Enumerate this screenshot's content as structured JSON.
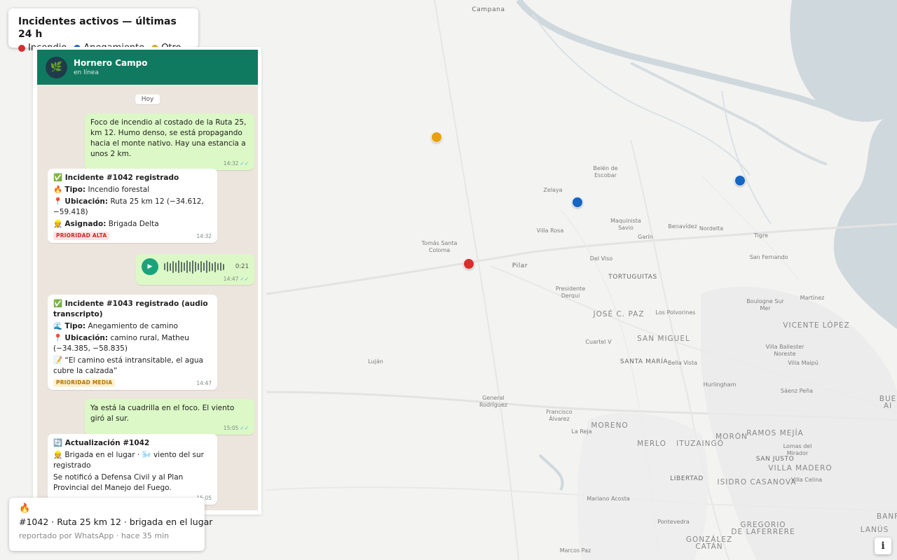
{
  "map": {
    "labels": [
      {
        "text": "Campana",
        "cls": "city"
      },
      {
        "text": "Belén de\nEscobar",
        "cls": ""
      },
      {
        "text": "Zelaya",
        "cls": ""
      },
      {
        "text": "Maquinista\nSavio",
        "cls": ""
      },
      {
        "text": "Benavídez",
        "cls": ""
      },
      {
        "text": "Nordelta",
        "cls": ""
      },
      {
        "text": "Tigre",
        "cls": ""
      },
      {
        "text": "Villa Rosa",
        "cls": ""
      },
      {
        "text": "Garín",
        "cls": ""
      },
      {
        "text": "Tomás Santa\nColoma",
        "cls": ""
      },
      {
        "text": "Pilar",
        "cls": "city"
      },
      {
        "text": "Del Viso",
        "cls": ""
      },
      {
        "text": "San Fernando",
        "cls": ""
      },
      {
        "text": "TORTUGUITAS",
        "cls": "city"
      },
      {
        "text": "Presidente\nDerqui",
        "cls": ""
      },
      {
        "text": "Boulogne Sur\nMer",
        "cls": ""
      },
      {
        "text": "Martínez",
        "cls": ""
      },
      {
        "text": "JOSÉ C. PAZ",
        "cls": "big"
      },
      {
        "text": "Los Polvorines",
        "cls": ""
      },
      {
        "text": "VICENTE LÓPEZ",
        "cls": "big"
      },
      {
        "text": "SAN MIGUEL",
        "cls": "big"
      },
      {
        "text": "Cuartel V",
        "cls": ""
      },
      {
        "text": "Villa Ballester\nNoreste",
        "cls": ""
      },
      {
        "text": "Luján",
        "cls": ""
      },
      {
        "text": "SANTA MARÍA",
        "cls": "city"
      },
      {
        "text": "Bella Vista",
        "cls": ""
      },
      {
        "text": "Villa Maipú",
        "cls": ""
      },
      {
        "text": "Hurlingham",
        "cls": ""
      },
      {
        "text": "Sáenz Peña",
        "cls": ""
      },
      {
        "text": "BUE\nAI",
        "cls": "big"
      },
      {
        "text": "General\nRodríguez",
        "cls": ""
      },
      {
        "text": "Francisco\nÁlvarez",
        "cls": ""
      },
      {
        "text": "MORENO",
        "cls": "big"
      },
      {
        "text": "La Reja",
        "cls": ""
      },
      {
        "text": "RAMOS MEJÍA",
        "cls": "big"
      },
      {
        "text": "MORÓN",
        "cls": "big"
      },
      {
        "text": "MERLO",
        "cls": "big"
      },
      {
        "text": "ITUZAINGÓ",
        "cls": "big"
      },
      {
        "text": "Lomas del\nMirador",
        "cls": ""
      },
      {
        "text": "SAN JUSTO",
        "cls": "city"
      },
      {
        "text": "VILLA MADERO",
        "cls": "big"
      },
      {
        "text": "LIBERTAD",
        "cls": "city"
      },
      {
        "text": "ISIDRO CASANOVA",
        "cls": "big"
      },
      {
        "text": "Villa Celina",
        "cls": ""
      },
      {
        "text": "Mariano Acosta",
        "cls": ""
      },
      {
        "text": "Pontevedra",
        "cls": ""
      },
      {
        "text": "GREGORIO\nDE LAFERRERE",
        "cls": "big"
      },
      {
        "text": "LANÚS",
        "cls": "big"
      },
      {
        "text": "GONZÁLEZ\nCATÁN",
        "cls": "big"
      },
      {
        "text": "Marcos Paz",
        "cls": ""
      },
      {
        "text": "BANF",
        "cls": "big"
      }
    ],
    "markers": [
      {
        "type": "otro",
        "color": "#e6a10f"
      },
      {
        "type": "anegamiento",
        "color": "#1665c1"
      },
      {
        "type": "anegamiento",
        "color": "#1665c1"
      },
      {
        "type": "incendio",
        "color": "#d62d2d"
      }
    ]
  },
  "legend": {
    "title": "Incidentes activos — últimas 24 h",
    "items": [
      {
        "label": "Incendio",
        "color": "#d62d2d"
      },
      {
        "label": "Anegamiento",
        "color": "#1665c1"
      },
      {
        "label": "Otro",
        "color": "#e6a10f"
      }
    ]
  },
  "chat": {
    "contact_name": "Hornero Campo",
    "contact_status": "en línea",
    "avatar_icon": "🌿",
    "day_chip": "Hoy",
    "msg1": {
      "text": "Foco de incendio al costado de la Ruta 25, km 12. Humo denso, se está propagando hacia el monte nativo. Hay una estancia a unos 2 km.",
      "time": "14:32",
      "ticks": "✓✓"
    },
    "msg2": {
      "title": "✅ Incidente #1042 registrado",
      "tipo_icon": "🔥",
      "tipo_label": "Tipo:",
      "tipo_value": "Incendio forestal",
      "ubic_icon": "📍",
      "ubic_label": "Ubicación:",
      "ubic_value": "Ruta 25 km 12 (−34.612, −59.418)",
      "asig_icon": "👷",
      "asig_label": "Asignado:",
      "asig_value": "Brigada Delta",
      "badge": "PRIORIDAD ALTA",
      "time": "14:32"
    },
    "msg3": {
      "duration": "0:21",
      "time": "14:47",
      "ticks": "✓✓",
      "play_icon": "▶",
      "wave_level": [
        0.35,
        0.6,
        0.45,
        0.8,
        0.55,
        0.9,
        0.7,
        0.5,
        0.85,
        0.65,
        0.95,
        0.6,
        0.4,
        0.75,
        0.5,
        0.85,
        0.6,
        0.45,
        0.7,
        0.35,
        0.5,
        0.3
      ]
    },
    "msg4": {
      "title": "✅ Incidente #1043 registrado (audio transcripto)",
      "tipo_icon": "🌊",
      "tipo_label": "Tipo:",
      "tipo_value": "Anegamiento de camino",
      "ubic_icon": "📍",
      "ubic_label": "Ubicación:",
      "ubic_value": "camino rural, Matheu (−34.385, −58.835)",
      "quote_icon": "📝",
      "quote": "“El camino está intransitable, el agua cubre la calzada”",
      "badge": "PRIORIDAD MEDIA",
      "time": "14:47"
    },
    "msg5": {
      "text": "Ya está la cuadrilla en el foco. El viento giró al sur.",
      "time": "15:05",
      "ticks": "✓✓"
    },
    "msg6": {
      "title": "🔄 Actualización #1042",
      "line1": "👷 Brigada en el lugar · 🌬️ viento del sur registrado",
      "line2": "Se notificó a Defensa Civil y al Plan Provincial del Manejo del Fuego.",
      "time": "15:05"
    }
  },
  "toast": {
    "icon": "🔥",
    "title": "#1042 · Ruta 25 km 12 · brigada en el lugar",
    "subtitle": "reportado por WhatsApp · hace 35 min"
  },
  "info_button": "i"
}
